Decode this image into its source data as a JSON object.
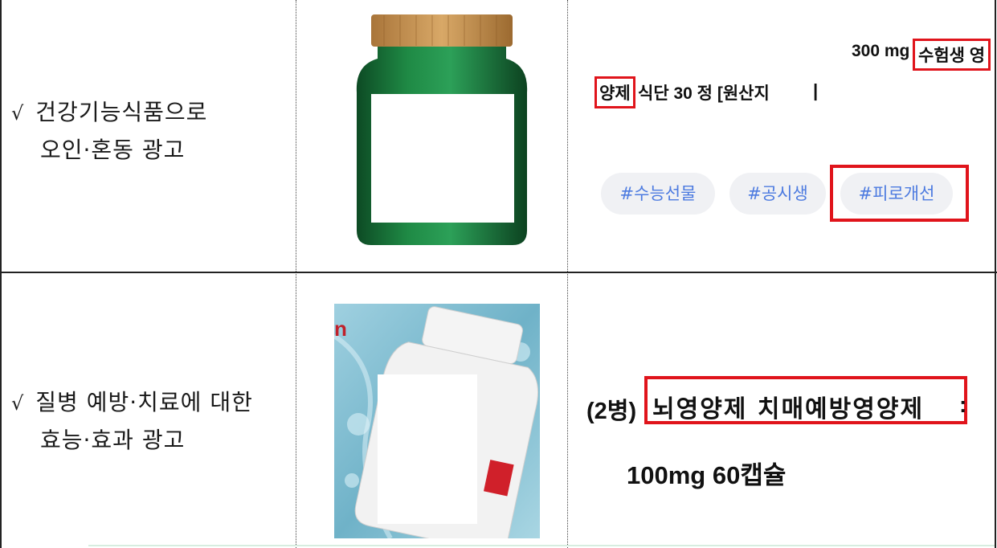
{
  "rows": [
    {
      "category_lines": [
        "건강기능식품으로",
        "오인·혼동 광고"
      ],
      "check": "√",
      "product_line1_prefix": "300 mg",
      "product_line1_hl": "수험생 영",
      "product_line2_hl": "양제",
      "product_line2_rest": "식단 30 정 [원산지",
      "cursor": "|",
      "tags": [
        "#수능선물",
        "#공시생",
        "#피로개선"
      ]
    },
    {
      "category_lines": [
        "질병 예방·치료에 대한",
        "효능·효과 광고"
      ],
      "check": "√",
      "product_prefix": "(2병)",
      "product_hl": "뇌영양제 치매예방영양제",
      "product_suffix": ":",
      "product_line2": "100mg 60캡슐"
    }
  ],
  "colors": {
    "highlight": "#e0141b",
    "tag_text": "#4d7be0",
    "tag_bg": "#f0f1f4"
  }
}
